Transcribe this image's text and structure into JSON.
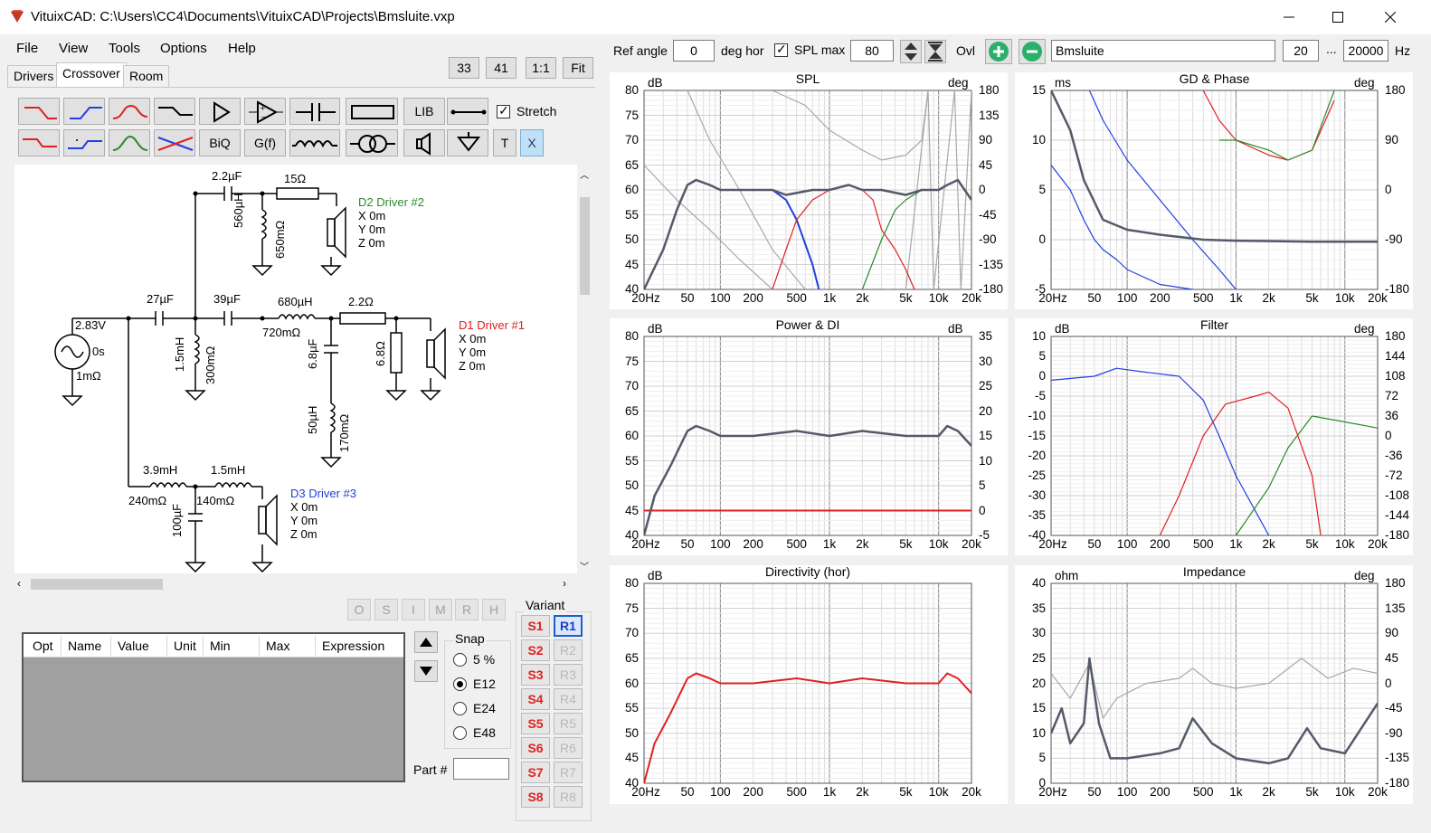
{
  "window": {
    "title": "VituixCAD: C:\\Users\\CC4\\Documents\\VituixCAD\\Projects\\Bmsluite.vxp",
    "minimize_icon": "minimize-icon",
    "maximize_icon": "maximize-icon",
    "close_icon": "close-icon"
  },
  "menu": [
    "File",
    "View",
    "Tools",
    "Options",
    "Help"
  ],
  "tabs": [
    "Drivers",
    "Crossover",
    "Room"
  ],
  "zoom_buttons": [
    "33",
    "41",
    "1:1",
    "Fit"
  ],
  "toolbar": {
    "lib": "LIB",
    "biq": "BiQ",
    "gf": "G(f)",
    "t": "T",
    "x": "X",
    "stretch_label": "Stretch",
    "stretch_checked": true
  },
  "schematic": {
    "source": {
      "voltage": "2.83V",
      "delay": "0s",
      "resistance": "1mΩ"
    },
    "parts": {
      "c1": "2.2µF",
      "r1": "15Ω",
      "l1": "560µH",
      "l1r": "650mΩ",
      "c2": "27µF",
      "c3": "39µF",
      "l2": "680µH",
      "l2r": "720mΩ",
      "r2": "2.2Ω",
      "l3": "1.5mH",
      "l3r": "300mΩ",
      "c4": "6.8µF",
      "r3": "6.8Ω",
      "l4": "50µH",
      "l4r": "170mΩ",
      "l5": "3.9mH",
      "l5r": "240mΩ",
      "l6": "1.5mH",
      "l6r": "140mΩ",
      "c5": "100µF"
    },
    "drivers": [
      {
        "name": "D2 Driver #2",
        "color": "#2a8a2a",
        "x": "X 0m",
        "y": "Y 0m",
        "z": "Z 0m"
      },
      {
        "name": "D1 Driver #1",
        "color": "#e02020",
        "x": "X 0m",
        "y": "Y 0m",
        "z": "Z 0m"
      },
      {
        "name": "D3 Driver #3",
        "color": "#2040e0",
        "x": "X 0m",
        "y": "Y 0m",
        "z": "Z 0m"
      }
    ]
  },
  "opt_buttons": [
    "O",
    "S",
    "I",
    "M",
    "R",
    "H"
  ],
  "table": {
    "columns": [
      "Opt",
      "Name",
      "Value",
      "Unit",
      "Min",
      "Max",
      "Expression"
    ]
  },
  "snap": {
    "label": "Snap",
    "options": [
      "5 %",
      "E12",
      "E24",
      "E48"
    ],
    "selected": "E12"
  },
  "part_label": "Part #",
  "variant": {
    "label": "Variant",
    "s": [
      "S1",
      "S2",
      "S3",
      "S4",
      "S5",
      "S6",
      "S7",
      "S8"
    ],
    "r": [
      "R1",
      "R2",
      "R3",
      "R4",
      "R5",
      "R6",
      "R7",
      "R8"
    ],
    "active": "R1"
  },
  "top_controls": {
    "ref_angle_label": "Ref angle",
    "ref_angle_value": "0",
    "deg_hor": "deg hor",
    "spl_max_label": "SPL max",
    "spl_max_checked": true,
    "spl_max_value": "80",
    "ovl_label": "Ovl",
    "overlay_name": "Bmsluite",
    "f_low": "20",
    "ellipsis": "...",
    "f_high": "20000",
    "hz": "Hz"
  },
  "freq_ticks": [
    "20Hz",
    "50",
    "100",
    "200",
    "500",
    "1k",
    "2k",
    "5k",
    "10k",
    "20k"
  ],
  "graphs": {
    "spl": {
      "title": "SPL",
      "yl_unit": "dB",
      "yr_unit": "deg",
      "yl": [
        "80",
        "75",
        "70",
        "65",
        "60",
        "55",
        "50",
        "45",
        "40"
      ],
      "yr": [
        "180",
        "135",
        "90",
        "45",
        "0",
        "-45",
        "-90",
        "-135",
        "-180"
      ]
    },
    "gd": {
      "title": "GD & Phase",
      "yl_unit": "ms",
      "yr_unit": "deg",
      "yl": [
        "15",
        "10",
        "5",
        "0",
        "-5"
      ],
      "yr": [
        "180",
        "90",
        "0",
        "-90",
        "-180"
      ]
    },
    "power": {
      "title": "Power & DI",
      "yl_unit": "dB",
      "yr_unit": "dB",
      "yl": [
        "80",
        "75",
        "70",
        "65",
        "60",
        "55",
        "50",
        "45",
        "40"
      ],
      "yr": [
        "35",
        "30",
        "25",
        "20",
        "15",
        "10",
        "5",
        "0",
        "-5"
      ]
    },
    "filter": {
      "title": "Filter",
      "yl_unit": "dB",
      "yr_unit": "deg",
      "yl": [
        "10",
        "5",
        "0",
        "-5",
        "-10",
        "-15",
        "-20",
        "-25",
        "-30",
        "-35",
        "-40"
      ],
      "yr": [
        "180",
        "144",
        "108",
        "72",
        "36",
        "0",
        "-36",
        "-72",
        "-108",
        "-144",
        "-180"
      ]
    },
    "dir": {
      "title": "Directivity (hor)",
      "yl_unit": "dB",
      "yl": [
        "80",
        "75",
        "70",
        "65",
        "60",
        "55",
        "50",
        "45",
        "40"
      ]
    },
    "imp": {
      "title": "Impedance",
      "yl_unit": "ohm",
      "yr_unit": "deg",
      "yl": [
        "40",
        "35",
        "30",
        "25",
        "20",
        "15",
        "10",
        "5",
        "0"
      ],
      "yr": [
        "180",
        "135",
        "90",
        "45",
        "0",
        "-45",
        "-90",
        "-135",
        "-180"
      ]
    }
  },
  "colors": {
    "red": "#e02020",
    "green": "#2a8a2a",
    "blue": "#2040e0",
    "total": "#555a6a",
    "grey": "#a8a8a8"
  }
}
